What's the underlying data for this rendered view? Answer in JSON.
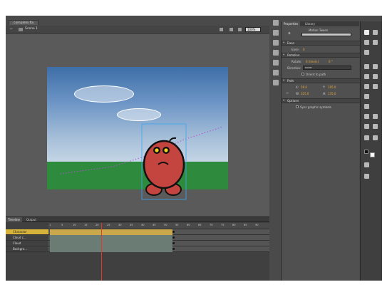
{
  "document": {
    "tab_label": "complete.fla"
  },
  "scene_bar": {
    "scene_label": "Scene 1",
    "zoom": "100%"
  },
  "timeline": {
    "tabs": [
      "Timeline",
      "Output"
    ],
    "ruler_ticks": [
      "1",
      "5",
      "10",
      "15",
      "20",
      "25",
      "30",
      "35",
      "40",
      "45",
      "50",
      "55",
      "60",
      "65",
      "70",
      "75",
      "80",
      "85",
      "90"
    ],
    "layers": [
      {
        "name": "Character",
        "selected": true
      },
      {
        "name": "Cloud c...",
        "selected": false
      },
      {
        "name": "Cloud",
        "selected": false
      },
      {
        "name": "Backgro...",
        "selected": false
      }
    ],
    "current_frame": 21
  },
  "properties": {
    "tabs": [
      "Properties",
      "Library"
    ],
    "instance_type": "Motion Tween",
    "sections": {
      "ease": "Ease",
      "rotation": "Rotation",
      "path": "Path",
      "options": "Options"
    },
    "ease_label": "Ease:",
    "ease_value": "0",
    "rotate_label": "Rotate:",
    "rotate_times": "0 time(s)",
    "rotate_degrees": "0 °",
    "direction_label": "Direction:",
    "direction_value": "none",
    "orient_label": "Orient to path",
    "path_x_label": "X:",
    "path_x": "56.0",
    "path_y_label": "Y:",
    "path_y": "195.0",
    "path_w_label": "W:",
    "path_w": "325.0",
    "path_h_label": "H:",
    "path_h": "135.0",
    "sync_label": "Sync graphic symbols"
  },
  "colors": {
    "character_body": "#c4453f",
    "ground": "#2e8b3e",
    "path_dots": "#b24fd0",
    "selected_layer": "#d7b33a",
    "playhead": "#e03a2a",
    "value_orange": "#e8a83a"
  }
}
